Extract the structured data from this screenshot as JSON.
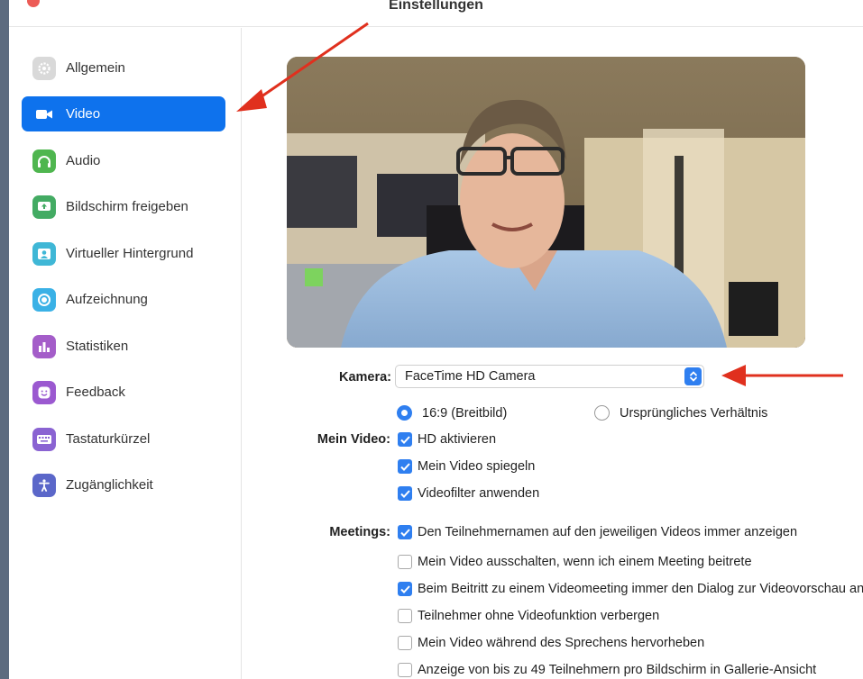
{
  "window": {
    "title": "Einstellungen"
  },
  "sidebar": {
    "items": [
      {
        "label": "Allgemein",
        "icon": "gear-icon",
        "color": "#d9d9d9",
        "active": false
      },
      {
        "label": "Video",
        "icon": "video-camera-icon",
        "color": "#0e72ed",
        "active": true
      },
      {
        "label": "Audio",
        "icon": "headphones-icon",
        "color": "#4fb64f",
        "active": false
      },
      {
        "label": "Bildschirm freigeben",
        "icon": "share-screen-icon",
        "color": "#43ab63",
        "active": false
      },
      {
        "label": "Virtueller Hintergrund",
        "icon": "person-background-icon",
        "color": "#3fb7d6",
        "active": false
      },
      {
        "label": "Aufzeichnung",
        "icon": "record-icon",
        "color": "#3ab1e6",
        "active": false
      },
      {
        "label": "Statistiken",
        "icon": "bar-chart-icon",
        "color": "#a45dc9",
        "active": false
      },
      {
        "label": "Feedback",
        "icon": "smiley-icon",
        "color": "#9b59d0",
        "active": false
      },
      {
        "label": "Tastaturkürzel",
        "icon": "keyboard-icon",
        "color": "#8a63d2",
        "active": false
      },
      {
        "label": "Zugänglichkeit",
        "icon": "accessibility-icon",
        "color": "#5b67c9",
        "active": false
      }
    ]
  },
  "camera": {
    "label": "Kamera:",
    "value": "FaceTime HD Camera"
  },
  "aspect": {
    "option1": "16:9 (Breitbild)",
    "option2": "Ursprüngliches Verhältnis",
    "selected": "option1"
  },
  "my_video": {
    "label": "Mein Video:",
    "options": [
      {
        "label": "HD aktivieren",
        "checked": true
      },
      {
        "label": "Mein Video spiegeln",
        "checked": true
      },
      {
        "label": "Videofilter anwenden",
        "checked": true
      }
    ]
  },
  "meetings": {
    "label": "Meetings:",
    "options": [
      {
        "label": "Den Teilnehmernamen auf den jeweiligen Videos immer anzeigen",
        "checked": true
      },
      {
        "label": "Mein Video ausschalten, wenn ich einem Meeting beitrete",
        "checked": false
      },
      {
        "label": "Beim Beitritt zu einem Videomeeting immer den Dialog zur Videovorschau anzeigen",
        "checked": true
      },
      {
        "label": "Teilnehmer ohne Videofunktion verbergen",
        "checked": false
      },
      {
        "label": "Mein Video während des Sprechens hervorheben",
        "checked": false
      },
      {
        "label": "Anzeige von bis zu 49 Teilnehmern pro Bildschirm in Gallerie-Ansicht",
        "checked": false
      }
    ]
  },
  "colors": {
    "accent": "#0e72ed",
    "checkbox": "#2f7ff0",
    "annotation_arrow": "#e0301e"
  }
}
